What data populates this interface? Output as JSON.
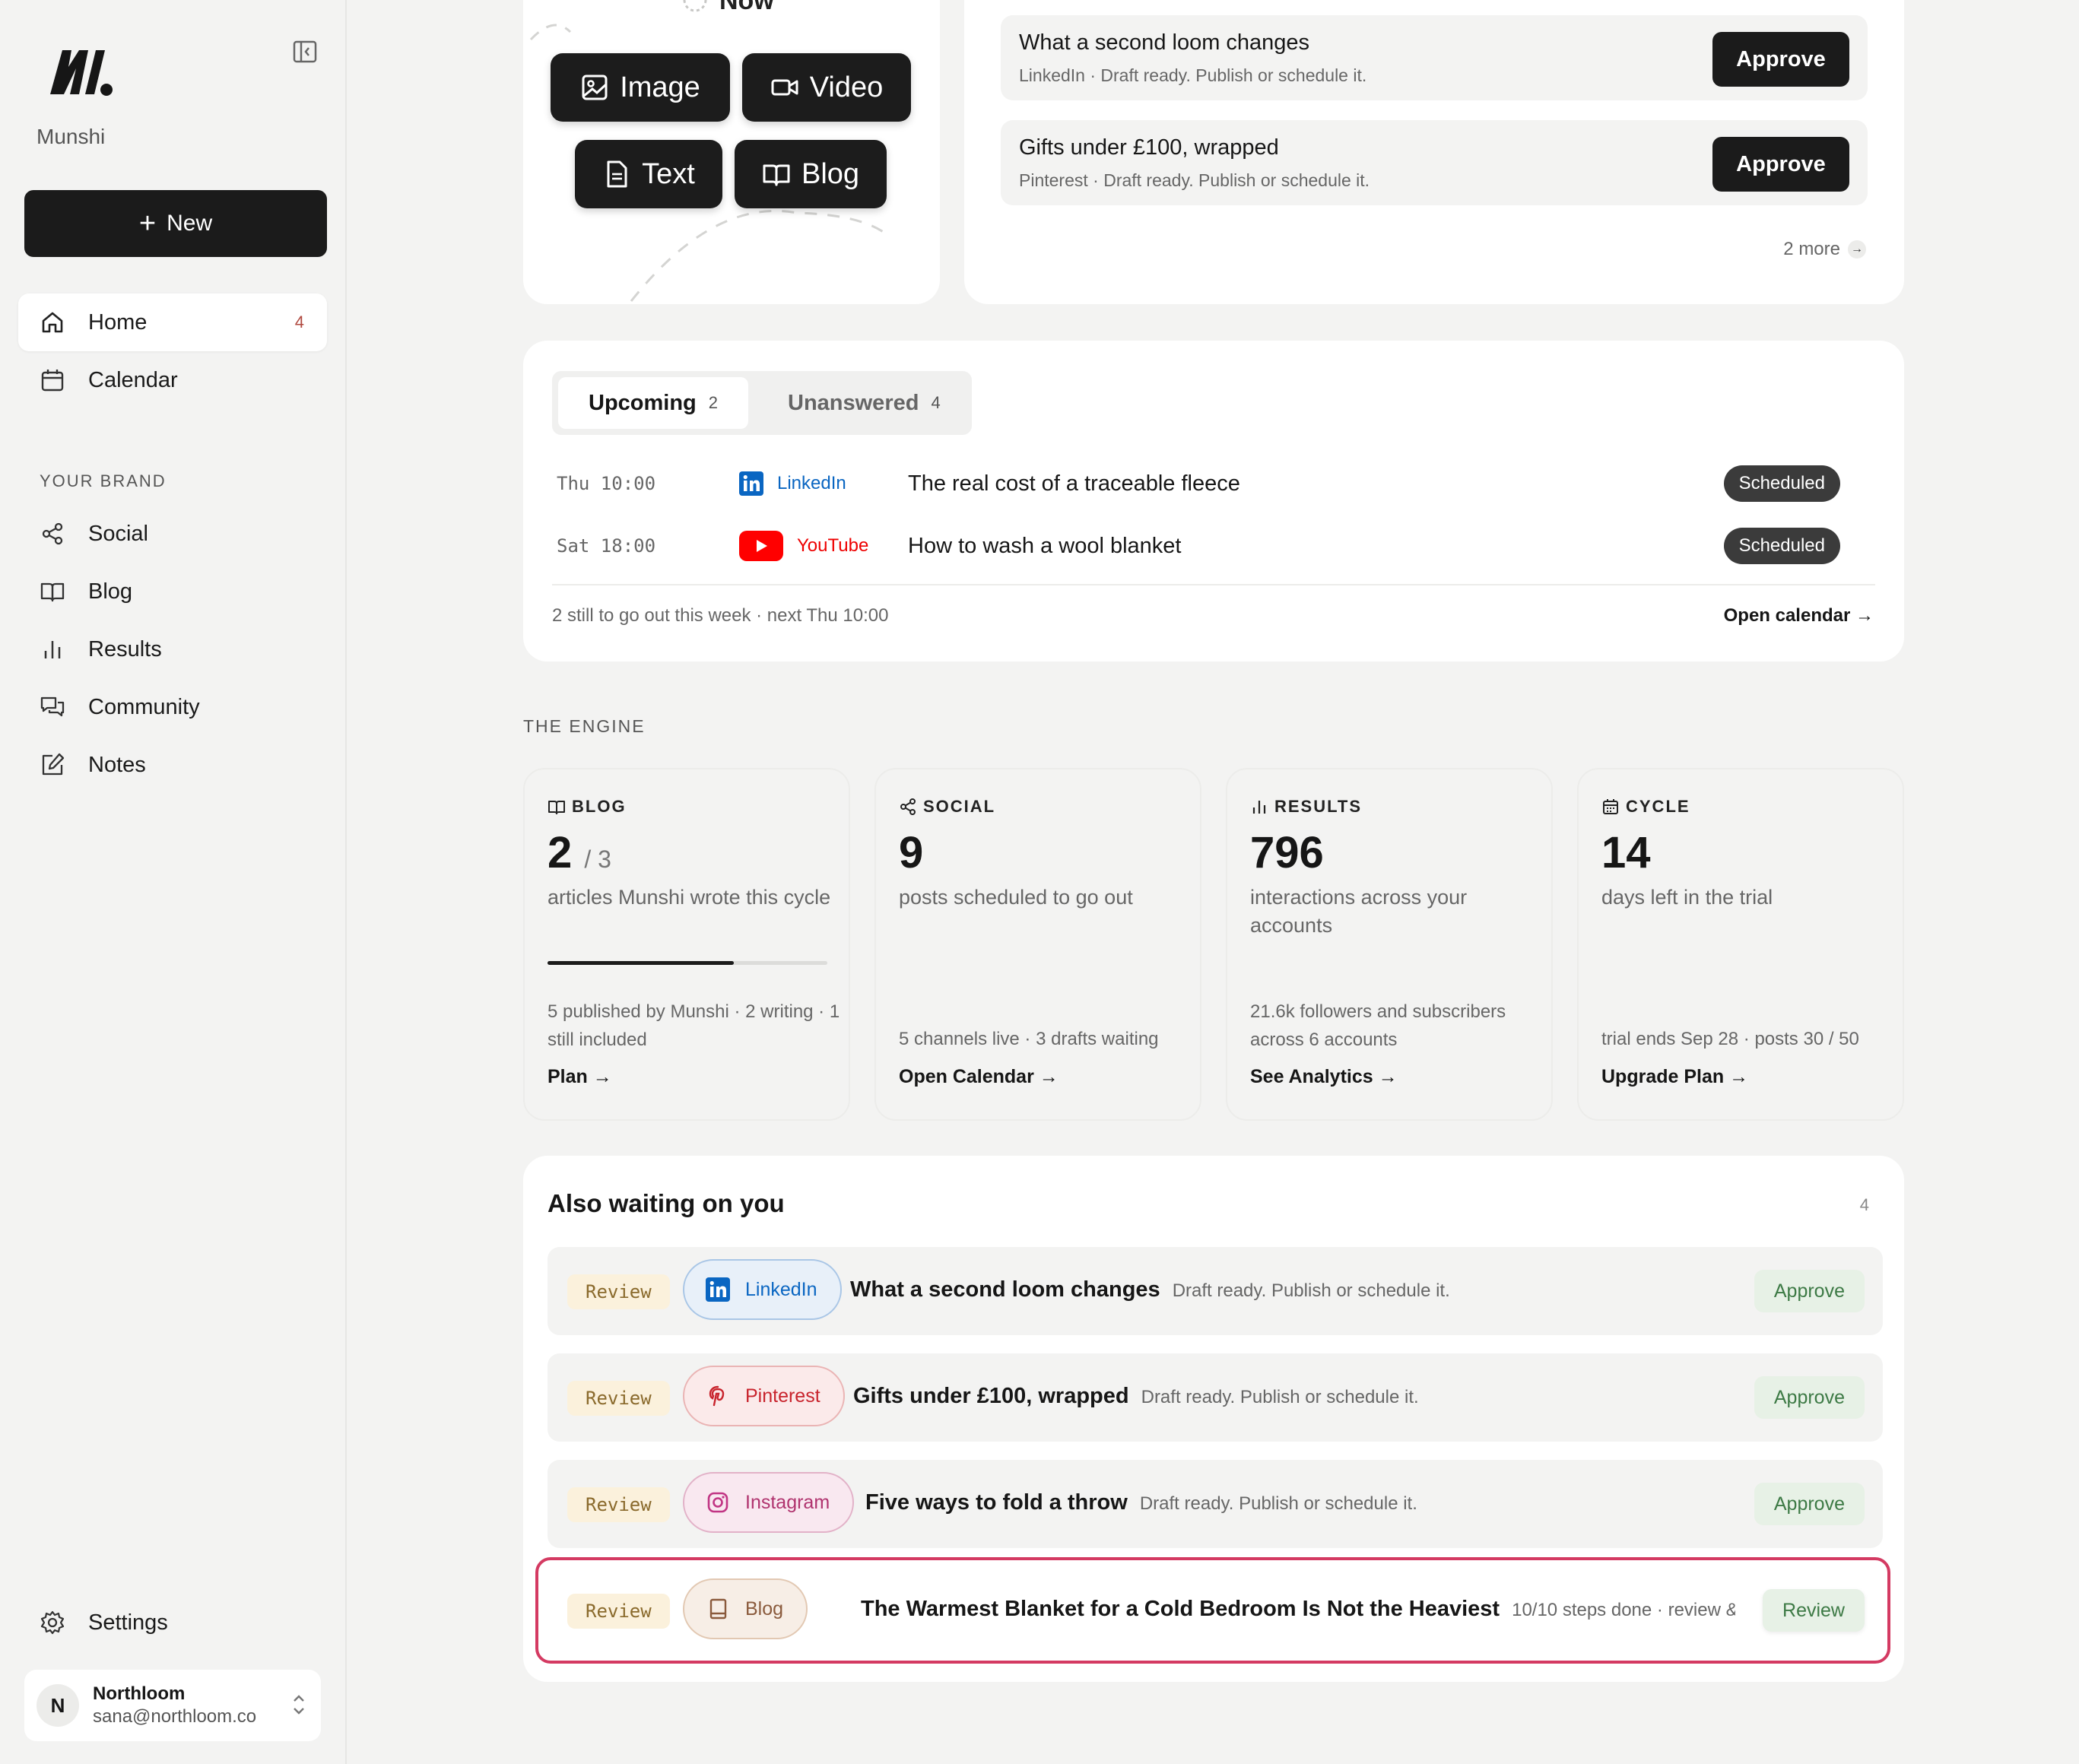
{
  "brand": {
    "name": "Munshi"
  },
  "sidebar": {
    "new_label": "New",
    "items": [
      {
        "label": "Home",
        "badge": "4"
      },
      {
        "label": "Calendar"
      }
    ],
    "section_label": "YOUR BRAND",
    "brand_items": [
      {
        "label": "Social"
      },
      {
        "label": "Blog"
      },
      {
        "label": "Results"
      },
      {
        "label": "Community"
      },
      {
        "label": "Notes"
      }
    ],
    "settings_label": "Settings",
    "account": {
      "initial": "N",
      "name": "Northloom",
      "email": "sana@northloom.co"
    }
  },
  "create": {
    "partial_label": "Now",
    "buttons": {
      "image": "Image",
      "video": "Video",
      "text": "Text",
      "blog": "Blog"
    }
  },
  "approvals": {
    "rows": [
      {
        "title": "What a second loom changes",
        "subtitle": "LinkedIn · Draft ready. Publish or schedule it.",
        "action": "Approve"
      },
      {
        "title": "Gifts under £100, wrapped",
        "subtitle": "Pinterest · Draft ready. Publish or schedule it.",
        "action": "Approve"
      }
    ],
    "more_label": "2 more"
  },
  "upcoming": {
    "tabs": [
      {
        "label": "Upcoming",
        "count": "2"
      },
      {
        "label": "Unanswered",
        "count": "4"
      }
    ],
    "rows": [
      {
        "time": "Thu 10:00",
        "platform": "LinkedIn",
        "title": "The real cost of a traceable fleece",
        "status": "Scheduled"
      },
      {
        "time": "Sat 18:00",
        "platform": "YouTube",
        "title": "How to wash a wool blanket",
        "status": "Scheduled"
      }
    ],
    "footer": "2 still to go out this week · next Thu 10:00",
    "link": "Open calendar →"
  },
  "engine": {
    "label": "THE ENGINE",
    "cards": [
      {
        "head": "BLOG",
        "value": "2",
        "of": "/ 3",
        "desc": "articles Munshi wrote this cycle",
        "progress": 0.667,
        "meta": "5 published by Munshi · 2 writing · 1 still included",
        "link": "Plan →"
      },
      {
        "head": "SOCIAL",
        "value": "9",
        "desc": "posts scheduled to go out",
        "meta": "5 channels live · 3 drafts waiting",
        "link": "Open Calendar →"
      },
      {
        "head": "RESULTS",
        "value": "796",
        "desc": "interactions across your accounts",
        "meta": "21.6k followers and subscribers across 6 accounts",
        "link": "See Analytics →"
      },
      {
        "head": "CYCLE",
        "value": "14",
        "desc": "days left in the trial",
        "meta": "trial ends Sep 28 · posts 30 / 50",
        "link": "Upgrade Plan →"
      }
    ]
  },
  "waiting": {
    "title": "Also waiting on you",
    "count": "4",
    "rows": [
      {
        "tag": "Review",
        "channel": "LinkedIn",
        "title": "What a second loom changes",
        "subtitle": "Draft ready. Publish or schedule it.",
        "action": "Approve"
      },
      {
        "tag": "Review",
        "channel": "Pinterest",
        "title": "Gifts under £100, wrapped",
        "subtitle": "Draft ready. Publish or schedule it.",
        "action": "Approve"
      },
      {
        "tag": "Review",
        "channel": "Instagram",
        "title": "Five ways to fold a throw",
        "subtitle": "Draft ready. Publish or schedule it.",
        "action": "Approve"
      },
      {
        "tag": "Review",
        "channel": "Blog",
        "title": "The Warmest Blanket for a Cold Bedroom Is Not the Heaviest",
        "subtitle": "10/10 steps done · review &...",
        "action": "Review"
      }
    ]
  },
  "colors": {
    "linkedin": "#0a66c2",
    "youtube": "#ff0000",
    "pinterest": "#c8232c",
    "instagram": "#b0336e",
    "highlight": "#d43a62"
  }
}
